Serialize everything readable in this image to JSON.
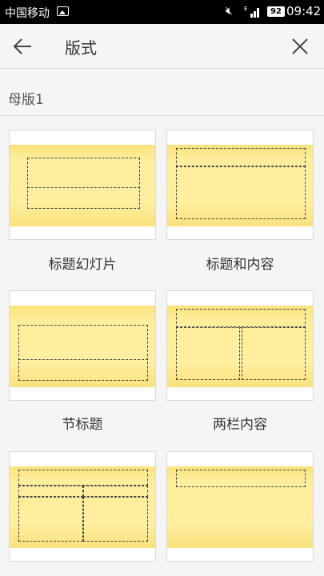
{
  "status_bar": {
    "carrier": "中国移动",
    "battery": "92",
    "time": "09:42"
  },
  "header": {
    "title": "版式",
    "back_icon": "arrow-left-icon",
    "close_icon": "close-icon"
  },
  "section": {
    "label": "母版1"
  },
  "layouts": [
    {
      "label": "标题幻灯片"
    },
    {
      "label": "标题和内容"
    },
    {
      "label": "节标题"
    },
    {
      "label": "两栏内容"
    },
    {
      "label": ""
    },
    {
      "label": ""
    }
  ],
  "colors": {
    "slide_yellow": "#fdee9e",
    "slide_yellow_edge": "#fbe17c",
    "background": "#f5f5f5"
  }
}
